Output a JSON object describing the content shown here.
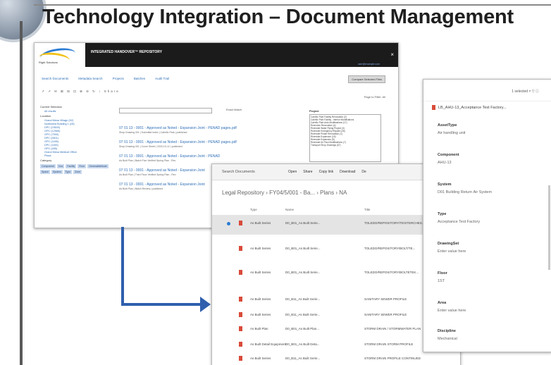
{
  "title": "Technology Integration – Document Management",
  "repo_window": {
    "brand_name": "Right Solutions",
    "header_title": "INTEGRATED HANDOVER™ REPOSITORY",
    "header_link": "user@example.com",
    "close_label": "×",
    "tabs": [
      "Search Documents",
      "Metadata Search",
      "Projects",
      "Batches",
      "Audit Trail"
    ],
    "compare_button": "Compare Selected Files",
    "toolbar_icons": "↗ ↗ ✉ ⊞ ⊟ ⊡ ⊕ ⊖ ↻ ↕",
    "share_label": "Share",
    "per_page": "Page to Filter: All",
    "left_panel": {
      "current_selection": "Current Selection",
      "all_results": "All results",
      "location_label": "Location",
      "locations": [
        "Grand Mesa Village (52)",
        "Northwest Building 1 (28)",
        "DPC (23500)",
        "GPC (12565)",
        "GPC (7590)",
        "DPC (3501)",
        "GPC (1185)",
        "DPC (1155)",
        "GPC (485)",
        "Grand Mesa Medical Office",
        "Plaza"
      ],
      "category_label": "Category",
      "categories": [
        "Component",
        "Doc",
        "Facility",
        "Floor",
        "GeneralAttribute",
        "Space",
        "System",
        "Type",
        "Zone"
      ]
    },
    "search_option": "Exact Match",
    "project": {
      "label": "Project",
      "items": [
        "Cabrillo Park Facility Renovation (2)",
        "Cabrillo Park Facility - Interior Modifications",
        "Cabrillo Park Auto Modifications (17)",
        "Riverview Renovation (4)",
        "Riverside Water Piping Project (3)",
        "Riverside Emergency Repairs (26)",
        "Riverside Phase Renovation (1)",
        "Riverside Expansion (15)",
        "Riverside Expansion (5)",
        "Riverside Air Flow Modifications (7)",
        "Transport Shop Drawings (67)"
      ]
    },
    "results": [
      {
        "title": "07 01 13 - 0001 - Approved as Noted - Expansion Joint - PENAD pages.pdf",
        "sub": "Shop Drawing 001 | Submittal Index | Cabrillo Park | published"
      },
      {
        "title": "07 01 13 - 0001 - Approved as Noted - Expansion Joint - PENAD pages.pdf",
        "sub": "Shop Drawing 001 | Cover Sheet | 2020-10-12 | published"
      },
      {
        "title": "07 01 13 - 0001 - Approved as Noted - Expansion Joint - PENAD",
        "sub": "As Built Plan | Batch Five Verified Spring Plan - Rev"
      },
      {
        "title": "07 01 13 - 0001 - Approved as Noted - Expansion Joint",
        "sub": "As Built Plan | Third Floor Verified Spring Plan - Rev"
      },
      {
        "title": "07 01 13 - 0001 - Approved as Noted - Expansion Joint",
        "sub": "As Built Plan | Batch Review | published"
      }
    ]
  },
  "docs_window": {
    "search": "Search Documents",
    "actions": [
      "Open",
      "Share",
      "Copy link",
      "Download",
      "De"
    ],
    "breadcrumb": "Legal Repository  ›  FY04/5/001 - Ba...  ›  Plans  ›  NA",
    "columns": [
      "Type",
      "Name",
      "Title"
    ],
    "rows": [
      {
        "type": "As Built Series",
        "name": "D0_B01_As Built Serie...",
        "title": "TOLEDO/REPOSITORY/TE/STERCHES...",
        "selected": true
      },
      {
        "type": "As Built Series",
        "name": "D0_B01_As Built Serie...",
        "title": "TOLEDO/REPOSITORY/BOLT/TE...",
        "selected": false
      },
      {
        "type": "As Built Series",
        "name": "D0_B01_As Built Serie...",
        "title": "TOLEDO/REPOSITORY/BOLTETEK...",
        "selected": false
      },
      {
        "type": "As Built Series",
        "name": "D0_B11_As Built Serie...",
        "title": "SANITARY SEWER PROFILE",
        "selected": false
      },
      {
        "type": "As Built Series",
        "name": "D0_B11_As Built Serie...",
        "title": "SANITARY SEWER PROFILE",
        "selected": false
      },
      {
        "type": "As Built Plan",
        "name": "D0_B01_As Built Plan...",
        "title": "STORM DRAIN / STORMWATER PLAN",
        "selected": false
      },
      {
        "type": "As Built Detail Equipment",
        "name": "D0_B01_As Built Deta...",
        "title": "STORM DRAIN STORM PROFILE",
        "selected": false
      },
      {
        "type": "As Built Series",
        "name": "D0_B11_As Built Serie...",
        "title": "STORM DRAIN PROFILE CONTINUED",
        "selected": false
      }
    ]
  },
  "props_window": {
    "selected": "1 selected  ×   ▽   ⓘ",
    "file": "LB_AHU-13_Acceptance Test Factory...",
    "fields": [
      {
        "key": "AssetType",
        "value": "Air handling unit"
      },
      {
        "key": "Component",
        "value": "AHU-13"
      },
      {
        "key": "System",
        "value": "D01 Building Return Air System"
      },
      {
        "key": "Type",
        "value": "Acceptance Test Factory"
      },
      {
        "key": "DrawingSet",
        "value": "Enter value here"
      },
      {
        "key": "Floor",
        "value": "1ST"
      },
      {
        "key": "Area",
        "value": "Enter value here"
      },
      {
        "key": "Discipline",
        "value": "Mechanical"
      }
    ]
  }
}
